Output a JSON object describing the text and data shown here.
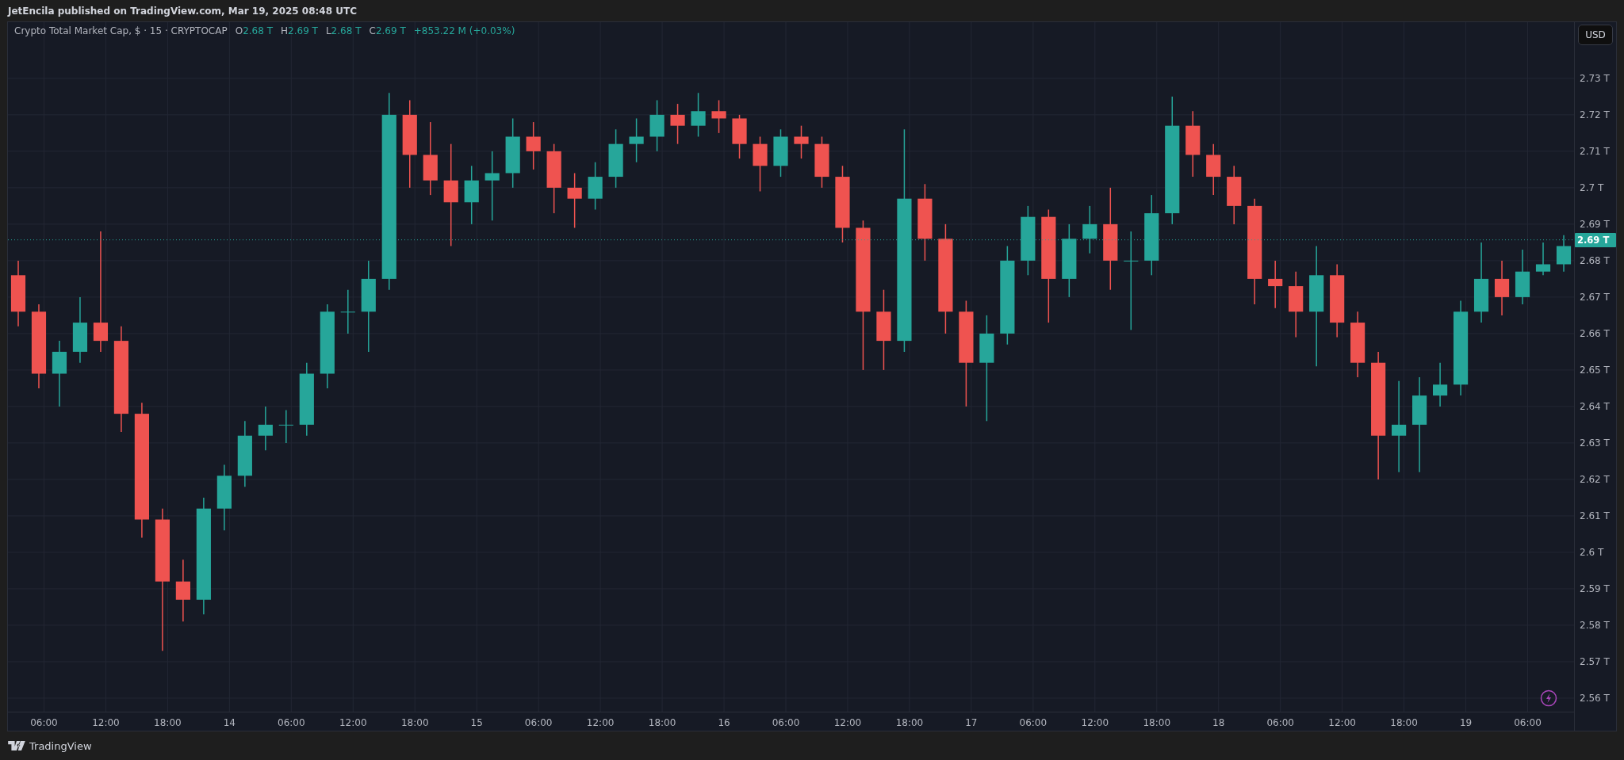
{
  "header": {
    "text": "JetEncila published on TradingView.com, Mar 19, 2025 08:48 UTC"
  },
  "legend": {
    "ohlc": [
      {
        "label": "O",
        "value": "2.68 T"
      },
      {
        "label": "H",
        "value": "2.69 T"
      },
      {
        "label": "L",
        "value": "2.68 T"
      },
      {
        "label": "C",
        "value": "2.69 T"
      }
    ],
    "change": "+853.22 M (+0.03%)"
  },
  "currency_button": {
    "label": "USD"
  },
  "chart_data": {
    "type": "candlestick",
    "title": "Crypto Total Market Cap, $ · 15 · CRYPTOCAP",
    "xlim": [
      "2025-03-13T02:30",
      "2025-03-19T10:30"
    ],
    "grid": true,
    "ylim": [
      2.5563,
      2.7454
    ],
    "x": [
      "2025-03-13T03:30",
      "2025-03-13T05:30",
      "2025-03-13T07:30",
      "2025-03-13T09:30",
      "2025-03-13T11:30",
      "2025-03-13T13:30",
      "2025-03-13T15:30",
      "2025-03-13T17:30",
      "2025-03-13T19:30",
      "2025-03-13T21:30",
      "2025-03-13T23:30",
      "2025-03-14T01:30",
      "2025-03-14T03:30",
      "2025-03-14T05:30",
      "2025-03-14T07:30",
      "2025-03-14T09:30",
      "2025-03-14T11:30",
      "2025-03-14T13:30",
      "2025-03-14T15:30",
      "2025-03-14T17:30",
      "2025-03-14T19:30",
      "2025-03-14T21:30",
      "2025-03-14T23:30",
      "2025-03-15T01:30",
      "2025-03-15T03:30",
      "2025-03-15T05:30",
      "2025-03-15T07:30",
      "2025-03-15T09:30",
      "2025-03-15T11:30",
      "2025-03-15T13:30",
      "2025-03-15T15:30",
      "2025-03-15T17:30",
      "2025-03-15T19:30",
      "2025-03-15T21:30",
      "2025-03-15T23:30",
      "2025-03-16T01:30",
      "2025-03-16T03:30",
      "2025-03-16T05:30",
      "2025-03-16T07:30",
      "2025-03-16T09:30",
      "2025-03-16T11:30",
      "2025-03-16T13:30",
      "2025-03-16T15:30",
      "2025-03-16T17:30",
      "2025-03-16T19:30",
      "2025-03-16T21:30",
      "2025-03-16T23:30",
      "2025-03-17T01:30",
      "2025-03-17T03:30",
      "2025-03-17T05:30",
      "2025-03-17T07:30",
      "2025-03-17T09:30",
      "2025-03-17T11:30",
      "2025-03-17T13:30",
      "2025-03-17T15:30",
      "2025-03-17T17:30",
      "2025-03-17T19:30",
      "2025-03-17T21:30",
      "2025-03-17T23:30",
      "2025-03-18T01:30",
      "2025-03-18T03:30",
      "2025-03-18T05:30",
      "2025-03-18T07:30",
      "2025-03-18T09:30",
      "2025-03-18T11:30",
      "2025-03-18T13:30",
      "2025-03-18T15:30",
      "2025-03-18T17:30",
      "2025-03-18T19:30",
      "2025-03-18T21:30",
      "2025-03-18T23:30",
      "2025-03-19T01:30",
      "2025-03-19T03:30",
      "2025-03-19T05:30",
      "2025-03-19T07:30",
      "2025-03-19T09:30"
    ],
    "ohlc": [
      [
        2.676,
        2.68,
        2.662,
        2.666
      ],
      [
        2.666,
        2.668,
        2.645,
        2.649
      ],
      [
        2.649,
        2.658,
        2.64,
        2.655
      ],
      [
        2.655,
        2.67,
        2.652,
        2.663
      ],
      [
        2.663,
        2.688,
        2.655,
        2.658
      ],
      [
        2.658,
        2.662,
        2.633,
        2.638
      ],
      [
        2.638,
        2.641,
        2.604,
        2.609
      ],
      [
        2.609,
        2.612,
        2.573,
        2.592
      ],
      [
        2.592,
        2.598,
        2.581,
        2.587
      ],
      [
        2.587,
        2.615,
        2.583,
        2.612
      ],
      [
        2.612,
        2.624,
        2.606,
        2.621
      ],
      [
        2.621,
        2.636,
        2.618,
        2.632
      ],
      [
        2.632,
        2.64,
        2.628,
        2.635
      ],
      [
        2.635,
        2.639,
        2.63,
        2.635
      ],
      [
        2.635,
        2.652,
        2.632,
        2.649
      ],
      [
        2.649,
        2.668,
        2.645,
        2.666
      ],
      [
        2.666,
        2.672,
        2.66,
        2.666
      ],
      [
        2.666,
        2.68,
        2.655,
        2.675
      ],
      [
        2.675,
        2.726,
        2.672,
        2.72
      ],
      [
        2.72,
        2.724,
        2.7,
        2.709
      ],
      [
        2.709,
        2.718,
        2.698,
        2.702
      ],
      [
        2.702,
        2.712,
        2.684,
        2.696
      ],
      [
        2.696,
        2.706,
        2.69,
        2.702
      ],
      [
        2.702,
        2.71,
        2.691,
        2.704
      ],
      [
        2.704,
        2.719,
        2.7,
        2.714
      ],
      [
        2.714,
        2.718,
        2.705,
        2.71
      ],
      [
        2.71,
        2.712,
        2.693,
        2.7
      ],
      [
        2.7,
        2.704,
        2.689,
        2.697
      ],
      [
        2.697,
        2.707,
        2.694,
        2.703
      ],
      [
        2.703,
        2.716,
        2.7,
        2.712
      ],
      [
        2.712,
        2.719,
        2.707,
        2.714
      ],
      [
        2.714,
        2.724,
        2.71,
        2.72
      ],
      [
        2.72,
        2.723,
        2.712,
        2.717
      ],
      [
        2.717,
        2.726,
        2.714,
        2.721
      ],
      [
        2.721,
        2.724,
        2.715,
        2.719
      ],
      [
        2.719,
        2.72,
        2.708,
        2.712
      ],
      [
        2.712,
        2.714,
        2.699,
        2.706
      ],
      [
        2.706,
        2.716,
        2.703,
        2.714
      ],
      [
        2.714,
        2.717,
        2.708,
        2.712
      ],
      [
        2.712,
        2.714,
        2.7,
        2.703
      ],
      [
        2.703,
        2.706,
        2.685,
        2.689
      ],
      [
        2.689,
        2.691,
        2.65,
        2.666
      ],
      [
        2.666,
        2.672,
        2.65,
        2.658
      ],
      [
        2.658,
        2.716,
        2.655,
        2.697
      ],
      [
        2.697,
        2.701,
        2.68,
        2.686
      ],
      [
        2.686,
        2.69,
        2.66,
        2.666
      ],
      [
        2.666,
        2.669,
        2.64,
        2.652
      ],
      [
        2.652,
        2.665,
        2.636,
        2.66
      ],
      [
        2.66,
        2.684,
        2.657,
        2.68
      ],
      [
        2.68,
        2.695,
        2.676,
        2.692
      ],
      [
        2.692,
        2.694,
        2.663,
        2.675
      ],
      [
        2.675,
        2.69,
        2.67,
        2.686
      ],
      [
        2.686,
        2.695,
        2.682,
        2.69
      ],
      [
        2.69,
        2.7,
        2.672,
        2.68
      ],
      [
        2.68,
        2.688,
        2.661,
        2.68
      ],
      [
        2.68,
        2.698,
        2.676,
        2.693
      ],
      [
        2.693,
        2.725,
        2.69,
        2.717
      ],
      [
        2.717,
        2.721,
        2.703,
        2.709
      ],
      [
        2.709,
        2.712,
        2.698,
        2.703
      ],
      [
        2.703,
        2.706,
        2.69,
        2.695
      ],
      [
        2.695,
        2.697,
        2.668,
        2.675
      ],
      [
        2.675,
        2.68,
        2.667,
        2.673
      ],
      [
        2.673,
        2.677,
        2.659,
        2.666
      ],
      [
        2.666,
        2.684,
        2.651,
        2.676
      ],
      [
        2.676,
        2.679,
        2.659,
        2.663
      ],
      [
        2.663,
        2.666,
        2.648,
        2.652
      ],
      [
        2.652,
        2.655,
        2.62,
        2.632
      ],
      [
        2.632,
        2.647,
        2.622,
        2.635
      ],
      [
        2.635,
        2.648,
        2.622,
        2.643
      ],
      [
        2.643,
        2.652,
        2.64,
        2.646
      ],
      [
        2.646,
        2.669,
        2.643,
        2.666
      ],
      [
        2.666,
        2.685,
        2.663,
        2.675
      ],
      [
        2.675,
        2.68,
        2.665,
        2.67
      ],
      [
        2.67,
        2.683,
        2.668,
        2.677
      ],
      [
        2.677,
        2.685,
        2.676,
        2.679
      ],
      [
        2.679,
        2.687,
        2.677,
        2.684
      ]
    ],
    "xticks": [
      {
        "value": "2025-03-13T06:00",
        "label": "06:00"
      },
      {
        "value": "2025-03-13T12:00",
        "label": "12:00"
      },
      {
        "value": "2025-03-13T18:00",
        "label": "18:00"
      },
      {
        "value": "2025-03-14T00:00",
        "label": "14"
      },
      {
        "value": "2025-03-14T06:00",
        "label": "06:00"
      },
      {
        "value": "2025-03-14T12:00",
        "label": "12:00"
      },
      {
        "value": "2025-03-14T18:00",
        "label": "18:00"
      },
      {
        "value": "2025-03-15T00:00",
        "label": "15"
      },
      {
        "value": "2025-03-15T06:00",
        "label": "06:00"
      },
      {
        "value": "2025-03-15T12:00",
        "label": "12:00"
      },
      {
        "value": "2025-03-15T18:00",
        "label": "18:00"
      },
      {
        "value": "2025-03-16T00:00",
        "label": "16"
      },
      {
        "value": "2025-03-16T06:00",
        "label": "06:00"
      },
      {
        "value": "2025-03-16T12:00",
        "label": "12:00"
      },
      {
        "value": "2025-03-16T18:00",
        "label": "18:00"
      },
      {
        "value": "2025-03-17T00:00",
        "label": "17"
      },
      {
        "value": "2025-03-17T06:00",
        "label": "06:00"
      },
      {
        "value": "2025-03-17T12:00",
        "label": "12:00"
      },
      {
        "value": "2025-03-17T18:00",
        "label": "18:00"
      },
      {
        "value": "2025-03-18T00:00",
        "label": "18"
      },
      {
        "value": "2025-03-18T06:00",
        "label": "06:00"
      },
      {
        "value": "2025-03-18T12:00",
        "label": "12:00"
      },
      {
        "value": "2025-03-18T18:00",
        "label": "18:00"
      },
      {
        "value": "2025-03-19T00:00",
        "label": "19"
      },
      {
        "value": "2025-03-19T06:00",
        "label": "06:00"
      }
    ],
    "yticks": [
      {
        "value": 2.73,
        "label": "2.73 T"
      },
      {
        "value": 2.72,
        "label": "2.72 T"
      },
      {
        "value": 2.71,
        "label": "2.71 T"
      },
      {
        "value": 2.7,
        "label": "2.7 T"
      },
      {
        "value": 2.69,
        "label": "2.69 T"
      },
      {
        "value": 2.68,
        "label": "2.68 T"
      },
      {
        "value": 2.67,
        "label": "2.67 T"
      },
      {
        "value": 2.66,
        "label": "2.66 T"
      },
      {
        "value": 2.65,
        "label": "2.65 T"
      },
      {
        "value": 2.64,
        "label": "2.64 T"
      },
      {
        "value": 2.63,
        "label": "2.63 T"
      },
      {
        "value": 2.62,
        "label": "2.62 T"
      },
      {
        "value": 2.61,
        "label": "2.61 T"
      },
      {
        "value": 2.6,
        "label": "2.6 T"
      },
      {
        "value": 2.59,
        "label": "2.59 T"
      },
      {
        "value": 2.58,
        "label": "2.58 T"
      },
      {
        "value": 2.57,
        "label": "2.57 T"
      },
      {
        "value": 2.56,
        "label": "2.56 T"
      }
    ],
    "ref_lines": [
      {
        "axis": "y",
        "value": 2.6857,
        "label": "2.69 T"
      }
    ]
  },
  "footer": {
    "brand": "TradingView"
  }
}
